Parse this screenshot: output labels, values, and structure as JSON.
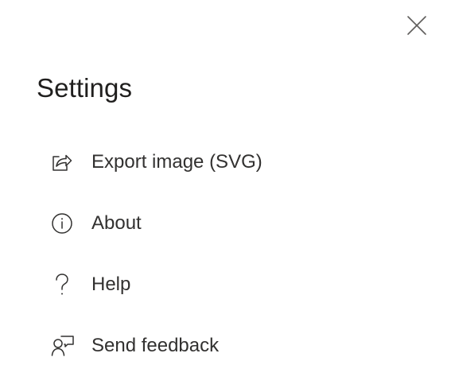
{
  "panel": {
    "title": "Settings",
    "close_icon": "close-icon"
  },
  "menu": {
    "items": [
      {
        "label": "Export image (SVG)",
        "icon": "share-export-icon"
      },
      {
        "label": "About",
        "icon": "info-icon"
      },
      {
        "label": "Help",
        "icon": "question-mark-icon"
      },
      {
        "label": "Send feedback",
        "icon": "person-feedback-icon"
      }
    ]
  },
  "colors": {
    "background": "#ffffff",
    "text": "#201f1e",
    "icon": "#323130"
  }
}
